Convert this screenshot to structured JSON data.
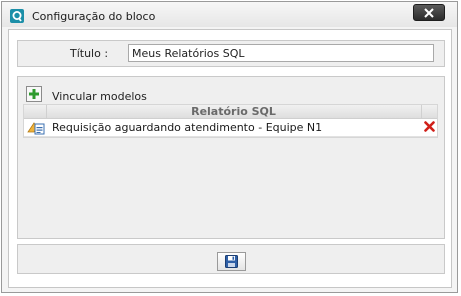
{
  "window": {
    "title": "Configuração do bloco",
    "close_icon": "close-x-icon",
    "app_icon": "app-logo-icon"
  },
  "form": {
    "title_label": "Título :",
    "title_value": "Meus Relatórios SQL"
  },
  "models": {
    "add_icon": "plus-icon",
    "link_label": "Vincular modelos",
    "table": {
      "columns": [
        "Relatório SQL"
      ],
      "rows": [
        {
          "icon": "report-icon",
          "name": "Requisição aguardando atendimento - Equipe N1",
          "delete_icon": "delete-x-icon"
        }
      ]
    }
  },
  "footer": {
    "save_icon": "save-disk-icon"
  },
  "colors": {
    "accent": "#1c8fa8",
    "delete": "#d0201a",
    "add": "#2e9a2e"
  }
}
